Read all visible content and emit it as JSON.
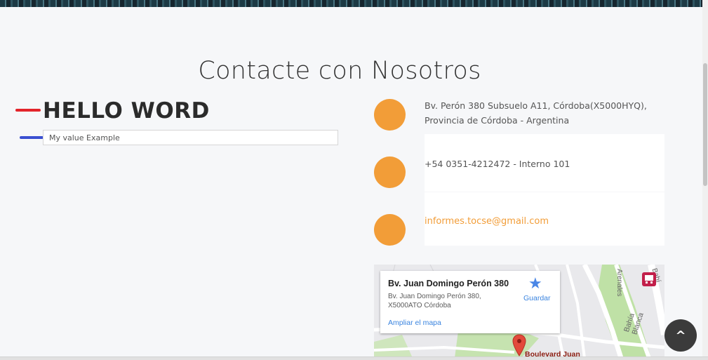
{
  "page": {
    "title": "Contacte con Nosotros"
  },
  "form": {
    "heading": "HELLO WORD",
    "input_value": "My value Example"
  },
  "contact": {
    "items": [
      {
        "icon": "map-marker-icon",
        "glyph": "",
        "lines": [
          "Bv. Perón 380 Subsuelo A11, Córdoba(X5000HYQ),",
          "Provincia de Córdoba - Argentina"
        ]
      },
      {
        "icon": "phone-icon",
        "glyph": "",
        "lines": [
          "+54 0351-4212472 - Interno 101"
        ]
      },
      {
        "icon": "envelope-icon",
        "glyph": "",
        "lines": [
          "informes.tocse@gmail.com"
        ]
      }
    ],
    "accent_color": "#f29d38"
  },
  "map": {
    "card": {
      "title": "Bv. Juan Domingo Perón 380",
      "address_line1": "Bv. Juan Domingo Perón 380,",
      "address_line2": "X5000ATO Córdoba",
      "enlarge_label": "Ampliar el mapa",
      "save_label": "Guardar"
    },
    "labels": {
      "road": "Boulevard Juan",
      "vertical_1": "Bahía Blanca",
      "vertical_2": "Arenales",
      "vertical_3": "Bahí"
    }
  },
  "scroll_top": {
    "label": "^"
  }
}
